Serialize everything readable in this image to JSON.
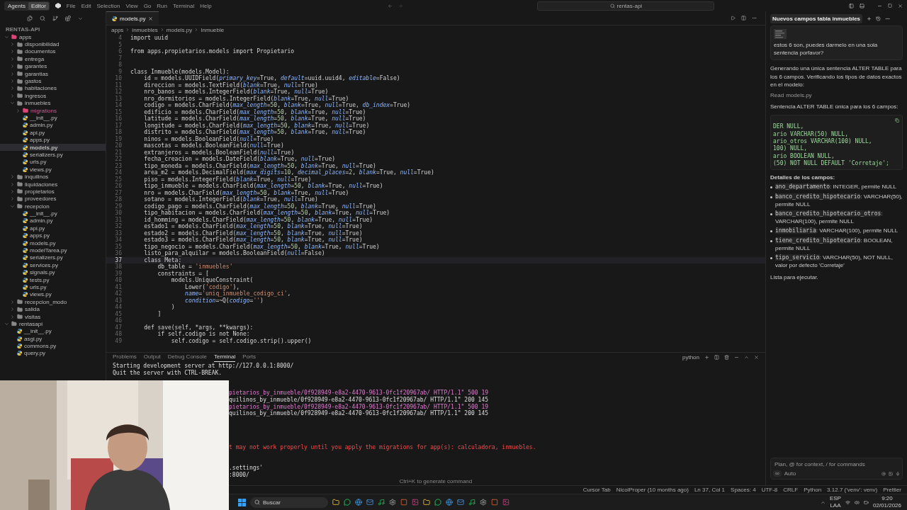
{
  "top_bar": {
    "modes": [
      {
        "label": "Agents",
        "selected": false
      },
      {
        "label": "Editor",
        "selected": true
      }
    ],
    "menu": [
      "File",
      "Edit",
      "Selection",
      "View",
      "Go",
      "Run",
      "Terminal",
      "Help"
    ],
    "search": "rentas-api"
  },
  "explorer": {
    "title": "RENTAS-API",
    "tree": [
      {
        "label": "apps",
        "kind": "special-folder",
        "expanded": true,
        "selected": false,
        "children": [
          {
            "label": "disponibilidad",
            "kind": "folder",
            "expanded": false,
            "selected": false
          },
          {
            "label": "documentos",
            "kind": "folder",
            "expanded": false,
            "selected": false
          },
          {
            "label": "entrega",
            "kind": "folder",
            "expanded": false,
            "selected": false
          },
          {
            "label": "garantes",
            "kind": "folder",
            "expanded": false,
            "selected": false
          },
          {
            "label": "garantias",
            "kind": "folder",
            "expanded": false,
            "selected": false
          },
          {
            "label": "gastos",
            "kind": "folder",
            "expanded": false,
            "selected": false
          },
          {
            "label": "habitaciones",
            "kind": "folder",
            "expanded": false,
            "selected": false
          },
          {
            "label": "ingresos",
            "kind": "folder",
            "expanded": false,
            "selected": false
          },
          {
            "label": "inmuebles",
            "kind": "folder",
            "expanded": true,
            "selected": false,
            "children": [
              {
                "label": "migrations",
                "kind": "special-folder",
                "expanded": false,
                "selected": false
              },
              {
                "label": "__init__.py",
                "kind": "file",
                "selected": false
              },
              {
                "label": "admin.py",
                "kind": "file",
                "selected": false
              },
              {
                "label": "api.py",
                "kind": "file",
                "selected": false
              },
              {
                "label": "apps.py",
                "kind": "file",
                "selected": false
              },
              {
                "label": "models.py",
                "kind": "file",
                "selected": true
              },
              {
                "label": "serializers.py",
                "kind": "file",
                "selected": false
              },
              {
                "label": "urls.py",
                "kind": "file",
                "selected": false
              },
              {
                "label": "views.py",
                "kind": "file",
                "selected": false
              }
            ]
          },
          {
            "label": "inquilinos",
            "kind": "folder",
            "expanded": false,
            "selected": false
          },
          {
            "label": "liquidaciones",
            "kind": "folder",
            "expanded": false,
            "selected": false
          },
          {
            "label": "propietarios",
            "kind": "folder",
            "expanded": false,
            "selected": false
          },
          {
            "label": "proveedores",
            "kind": "folder",
            "expanded": false,
            "selected": false
          },
          {
            "label": "recepcion",
            "kind": "folder",
            "expanded": true,
            "selected": false,
            "children": [
              {
                "label": "__init__.py",
                "kind": "file",
                "selected": false
              },
              {
                "label": "admin.py",
                "kind": "file",
                "selected": false
              },
              {
                "label": "api.py",
                "kind": "file",
                "selected": false
              },
              {
                "label": "apps.py",
                "kind": "file",
                "selected": false
              },
              {
                "label": "models.py",
                "kind": "file",
                "selected": false
              },
              {
                "label": "modelTarea.py",
                "kind": "file",
                "selected": false
              },
              {
                "label": "serializers.py",
                "kind": "file",
                "selected": false
              },
              {
                "label": "services.py",
                "kind": "file",
                "selected": false
              },
              {
                "label": "signals.py",
                "kind": "file",
                "selected": false
              },
              {
                "label": "tests.py",
                "kind": "file",
                "selected": false
              },
              {
                "label": "urls.py",
                "kind": "file",
                "selected": false
              },
              {
                "label": "views.py",
                "kind": "file",
                "selected": false
              }
            ]
          },
          {
            "label": "recepcion_modo",
            "kind": "folder",
            "expanded": false,
            "selected": false
          },
          {
            "label": "salida",
            "kind": "folder",
            "expanded": false,
            "selected": false
          },
          {
            "label": "visitas",
            "kind": "folder",
            "expanded": false,
            "selected": false
          }
        ]
      },
      {
        "label": "rentasapi",
        "kind": "folder",
        "expanded": true,
        "selected": false,
        "children": [
          {
            "label": "__init__.py",
            "kind": "file",
            "selected": false
          },
          {
            "label": "asgi.py",
            "kind": "file",
            "selected": false
          },
          {
            "label": "commons.py",
            "kind": "file",
            "selected": false
          },
          {
            "label": "query.py",
            "kind": "file",
            "selected": false
          }
        ]
      }
    ]
  },
  "editor": {
    "tabs": [
      {
        "label": "models.py",
        "selected": true
      }
    ],
    "breadcrumb": [
      "apps",
      "inmuebles",
      "models.py",
      "Inmueble"
    ],
    "lines": [
      {
        "n": "4",
        "text": "import uuid",
        "current": false
      },
      {
        "n": "5",
        "current": false
      },
      {
        "n": "6",
        "text": "from apps.propietarios.models import Propietario",
        "current": false
      },
      {
        "n": "7",
        "current": false
      },
      {
        "n": "8",
        "current": false
      },
      {
        "n": "9",
        "text": "class Inmueble(models.Model):",
        "current": false
      },
      {
        "n": "10",
        "text": "    id = models.UUIDField(primary_key=True, default=uuid.uuid4, editable=False)",
        "current": false
      },
      {
        "n": "11",
        "text": "    direccion = models.TextField(blank=True, null=True)",
        "current": false
      },
      {
        "n": "12",
        "text": "    nro_banos = models.IntegerField(blank=True, null=True)",
        "current": false
      },
      {
        "n": "13",
        "text": "    nro_dormitorios = models.IntegerField(blank=True, null=True)",
        "current": false
      },
      {
        "n": "14",
        "text": "    codigo = models.CharField(max_length=50, blank=True, null=True, db_index=True)",
        "current": false
      },
      {
        "n": "15",
        "text": "    edificio = models.CharField(max_length=50, blank=True, null=True)",
        "current": false
      },
      {
        "n": "16",
        "text": "    latitude = models.CharField(max_length=50, blank=True, null=True)",
        "current": false
      },
      {
        "n": "17",
        "text": "    longitude = models.CharField(max_length=50, blank=True, null=True)",
        "current": false
      },
      {
        "n": "18",
        "text": "    distrito = models.CharField(max_length=50, blank=True, null=True)",
        "current": false
      },
      {
        "n": "19",
        "text": "    ninos = models.BooleanField(null=True)",
        "current": false
      },
      {
        "n": "20",
        "text": "    mascotas = models.BooleanField(null=True)",
        "current": false
      },
      {
        "n": "21",
        "text": "    extranjeros = models.BooleanField(null=True)",
        "current": false
      },
      {
        "n": "22",
        "text": "    fecha_creacion = models.DateField(blank=True, null=True)",
        "current": false
      },
      {
        "n": "23",
        "text": "    tipo_moneda = models.CharField(max_length=50, blank=True, null=True)",
        "current": false
      },
      {
        "n": "24",
        "text": "    area_m2 = models.DecimalField(max_digits=10, decimal_places=2, blank=True, null=True)",
        "current": false
      },
      {
        "n": "25",
        "text": "    piso = models.IntegerField(blank=True, null=True)",
        "current": false
      },
      {
        "n": "26",
        "text": "    tipo_inmueble = models.CharField(max_length=50, blank=True, null=True)",
        "current": false
      },
      {
        "n": "27",
        "text": "    nro = models.CharField(max_length=50, blank=True, null=True)",
        "current": false
      },
      {
        "n": "28",
        "text": "    sotano = models.IntegerField(blank=True, null=True)",
        "current": false
      },
      {
        "n": "29",
        "text": "    codigo_pago = models.CharField(max_length=50, blank=True, null=True)",
        "current": false
      },
      {
        "n": "30",
        "text": "    tipo_habitacion = models.CharField(max_length=50, blank=True, null=True)",
        "current": false
      },
      {
        "n": "31",
        "text": "    id_homming = models.CharField(max_length=50, blank=True, null=True)",
        "current": false
      },
      {
        "n": "32",
        "text": "    estado1 = models.CharField(max_length=50, blank=True, null=True)",
        "current": false
      },
      {
        "n": "33",
        "text": "    estado2 = models.CharField(max_length=50, blank=True, null=True)",
        "current": false
      },
      {
        "n": "34",
        "text": "    estado3 = models.CharField(max_length=50, blank=True, null=True)",
        "current": false
      },
      {
        "n": "35",
        "text": "    tipo_negocio = models.CharField(max_length=50, blank=True, null=True)",
        "current": false
      },
      {
        "n": "36",
        "text": "    listo_para_alquilar = models.BooleanField(null=False)",
        "current": false
      },
      {
        "n": "37",
        "text": "    class Meta:",
        "current": true
      },
      {
        "n": "38",
        "text": "        db_table = 'inmuebles'",
        "current": false
      },
      {
        "n": "39",
        "text": "        constraints = [",
        "current": false
      },
      {
        "n": "40",
        "text": "            models.UniqueConstraint(",
        "current": false
      },
      {
        "n": "41",
        "text": "                Lower('codigo'),",
        "current": false
      },
      {
        "n": "42",
        "text": "                name='uniq_inmueble_codigo_ci',",
        "current": false
      },
      {
        "n": "43",
        "text": "                condition=~Q(codigo='')",
        "current": false
      },
      {
        "n": "44",
        "text": "            )",
        "current": false
      },
      {
        "n": "45",
        "text": "        ]",
        "current": false
      },
      {
        "n": "46",
        "current": false
      },
      {
        "n": "47",
        "text": "    def save(self, *args, **kwargs):",
        "current": false
      },
      {
        "n": "48",
        "text": "        if self.codigo is not None:",
        "current": false
      },
      {
        "n": "49",
        "text": "            self.codigo = self.codigo.strip().upper()",
        "current": false
      }
    ]
  },
  "panel": {
    "tabs": [
      {
        "label": "Problems",
        "selected": false
      },
      {
        "label": "Output",
        "selected": false
      },
      {
        "label": "Debug Console",
        "selected": false
      },
      {
        "label": "Terminal",
        "selected": true
      },
      {
        "label": "Ports",
        "selected": false
      }
    ],
    "shell": "python",
    "lines": [
      {
        "text": "Starting development server at http://127.0.0.1:8000/",
        "kind": "plain"
      },
      {
        "text": "Quit the server with CTRL-BREAK.",
        "kind": "plain"
      },
      {
        "kind": "blank"
      },
      {
        "kind": "blank"
      },
      {
        "text": "pietarios_by_inmueble/0f928949-e8a2-4470-9613-0fc1f20967ab/ HTTP/1.1\" 500 19",
        "kind": "error-cut"
      },
      {
        "text": "quilinos_by_inmueble/0f928949-e8a2-4470-9613-0fc1f20967ab/ HTTP/1.1\" 200 145",
        "kind": "cut"
      },
      {
        "text": "pietarios_by_inmueble/0f928949-e8a2-4470-9613-0fc1f20967ab/ HTTP/1.1\" 500 19",
        "kind": "error-cut"
      },
      {
        "text": "quilinos_by_inmueble/0f928949-e8a2-4470-9613-0fc1f20967ab/ HTTP/1.1\" 200 145",
        "kind": "cut"
      },
      {
        "kind": "blank"
      },
      {
        "kind": "blank"
      },
      {
        "kind": "blank"
      },
      {
        "kind": "blank"
      },
      {
        "text": "t may not work properly until you apply the migrations for app(s): calculadora, inmuebles.",
        "kind": "warning-cut"
      },
      {
        "kind": "blank"
      },
      {
        "kind": "blank"
      },
      {
        "text": ".settings'",
        "kind": "cut"
      },
      {
        "text": ":8000/",
        "kind": "cut"
      }
    ],
    "hint": "Ctrl+K to generate command"
  },
  "chat": {
    "title": "Nuevos campos tabla inmuebles",
    "user_message": "estos 6 son, puedes darmelo en una sola sentencia porfavor?",
    "blocks": [
      {
        "kind": "paragraph",
        "text": "Generando una única sentencia ALTER TABLE para los 6 campos. Verificando los tipos de datos exactos en el modelo:"
      },
      {
        "kind": "read",
        "label": "Read",
        "file": "models.py"
      },
      {
        "kind": "paragraph",
        "text": "Sentencia ALTER TABLE única para los 6 campos:"
      },
      {
        "kind": "code",
        "lines": [
          "DER NULL,",
          "ario VARCHAR(50) NULL,",
          "ario_otros VARCHAR(100) NULL,",
          "100) NULL,",
          "ario BOOLEAN NULL,",
          "(50) NOT NULL DEFAULT 'Corretaje';"
        ]
      },
      {
        "kind": "heading",
        "text": "Detalles de los campos:"
      },
      {
        "kind": "list",
        "items": [
          {
            "code": "ano_departamento",
            "text": ": INTEGER, permite NULL"
          },
          {
            "code": "banco_credito_hipotecario",
            "text": ": VARCHAR(50), permite NULL"
          },
          {
            "code": "banco_credito_hipotecario_otros",
            "text": ": VARCHAR(100), permite NULL"
          },
          {
            "code": "inmobiliaria",
            "text": ": VARCHAR(100), permite NULL"
          },
          {
            "code": "tiene_credito_hipotecario",
            "text": ": BOOLEAN, permite NULL"
          },
          {
            "code": "tipo_servicio",
            "text": ": VARCHAR(50), NOT NULL, valor por defecto 'Corretaje'"
          }
        ]
      },
      {
        "kind": "paragraph",
        "text": "Lista para ejecutar."
      }
    ],
    "input_placeholder": "Plan, @ for context, / for commands",
    "mode": "∞",
    "model": "Auto"
  },
  "status_bar": [
    "Cursor Tab",
    "NicolProper (10 months ago)",
    "Ln 37, Col 1",
    "Spaces: 4",
    "UTF-8",
    "CRLF",
    "Python",
    "3.12.7 ('venv': venv)",
    "Prettier"
  ],
  "taskbar": {
    "search": "Buscar",
    "language": [
      "ESP",
      "LAA"
    ],
    "time": "9:20",
    "date": "02/01/2026"
  }
}
